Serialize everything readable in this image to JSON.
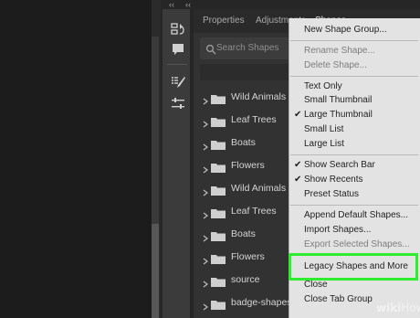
{
  "panel": {
    "tabs": [
      {
        "label": "Properties",
        "active": false
      },
      {
        "label": "Adjustments",
        "active": false
      },
      {
        "label": "Shapes",
        "active": true
      }
    ],
    "collapse_glyph": "‹‹",
    "search_placeholder": "Search Shapes",
    "groups": [
      {
        "label": "Wild Animals"
      },
      {
        "label": "Leaf Trees"
      },
      {
        "label": "Boats"
      },
      {
        "label": "Flowers"
      },
      {
        "label": "Wild Animals"
      },
      {
        "label": "Leaf Trees"
      },
      {
        "label": "Boats"
      },
      {
        "label": "Flowers"
      },
      {
        "label": "source"
      },
      {
        "label": "badge-shapes"
      }
    ]
  },
  "menu": {
    "check_glyph": "✔",
    "items": [
      {
        "label": "New Shape Group...",
        "checked": false,
        "disabled": false
      },
      {
        "label": "Rename Shape...",
        "checked": false,
        "disabled": true
      },
      {
        "label": "Delete Shape...",
        "checked": false,
        "disabled": true
      },
      {
        "label": "Text Only",
        "checked": false,
        "disabled": false
      },
      {
        "label": "Small Thumbnail",
        "checked": false,
        "disabled": false
      },
      {
        "label": "Large Thumbnail",
        "checked": true,
        "disabled": false
      },
      {
        "label": "Small List",
        "checked": false,
        "disabled": false
      },
      {
        "label": "Large List",
        "checked": false,
        "disabled": false
      },
      {
        "label": "Show Search Bar",
        "checked": true,
        "disabled": false
      },
      {
        "label": "Show Recents",
        "checked": true,
        "disabled": false
      },
      {
        "label": "Preset Status",
        "checked": false,
        "disabled": false
      },
      {
        "label": "Append Default Shapes...",
        "checked": false,
        "disabled": false
      },
      {
        "label": "Import Shapes...",
        "checked": false,
        "disabled": false
      },
      {
        "label": "Export Selected Shapes...",
        "checked": false,
        "disabled": true
      },
      {
        "label": "Legacy Shapes and More",
        "checked": false,
        "disabled": false,
        "highlighted": true
      },
      {
        "label": "Close",
        "checked": false,
        "disabled": false
      },
      {
        "label": "Close Tab Group",
        "checked": false,
        "disabled": false
      }
    ]
  },
  "watermark": {
    "bold": "wiki",
    "rest": "How"
  },
  "colors": {
    "highlight": "#2eec2e",
    "menu_bg": "#e3e3e3",
    "panel_bg": "#323232"
  }
}
